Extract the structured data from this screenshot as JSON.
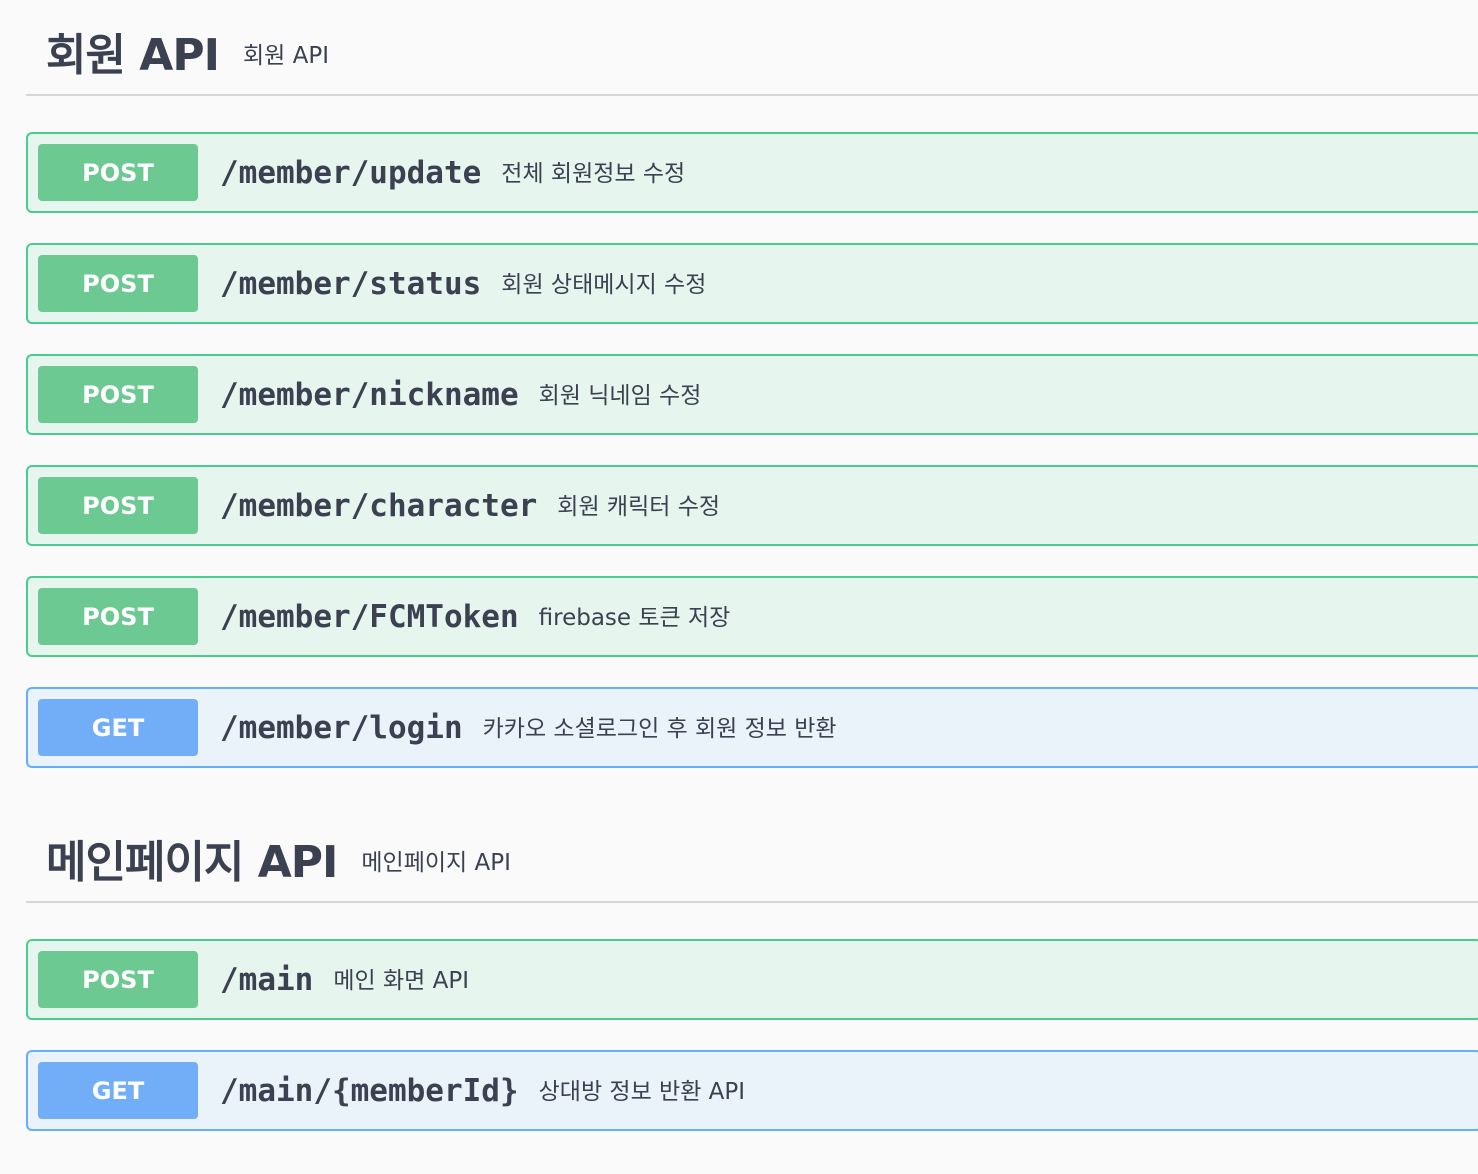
{
  "sections": [
    {
      "title": "회원 API",
      "description": "회원 API",
      "operations": [
        {
          "method": "POST",
          "path": "/member/update",
          "summary": "전체 회원정보 수정"
        },
        {
          "method": "POST",
          "path": "/member/status",
          "summary": "회원 상태메시지 수정"
        },
        {
          "method": "POST",
          "path": "/member/nickname",
          "summary": "회원 닉네임 수정"
        },
        {
          "method": "POST",
          "path": "/member/character",
          "summary": "회원 캐릭터 수정"
        },
        {
          "method": "POST",
          "path": "/member/FCMToken",
          "summary": "firebase 토큰 저장"
        },
        {
          "method": "GET",
          "path": "/member/login",
          "summary": "카카오 소셜로그인 후 회원 정보 반환"
        }
      ]
    },
    {
      "title": "메인페이지 API",
      "description": "메인페이지 API",
      "operations": [
        {
          "method": "POST",
          "path": "/main",
          "summary": "메인 화면 API"
        },
        {
          "method": "GET",
          "path": "/main/{memberId}",
          "summary": "상대방 정보 반환 API"
        }
      ]
    }
  ],
  "colors": {
    "post_border": "#49cc90",
    "post_badge": "#6bc991",
    "get_border": "#61affe",
    "get_badge": "#72aef8",
    "text": "#3b4151"
  }
}
